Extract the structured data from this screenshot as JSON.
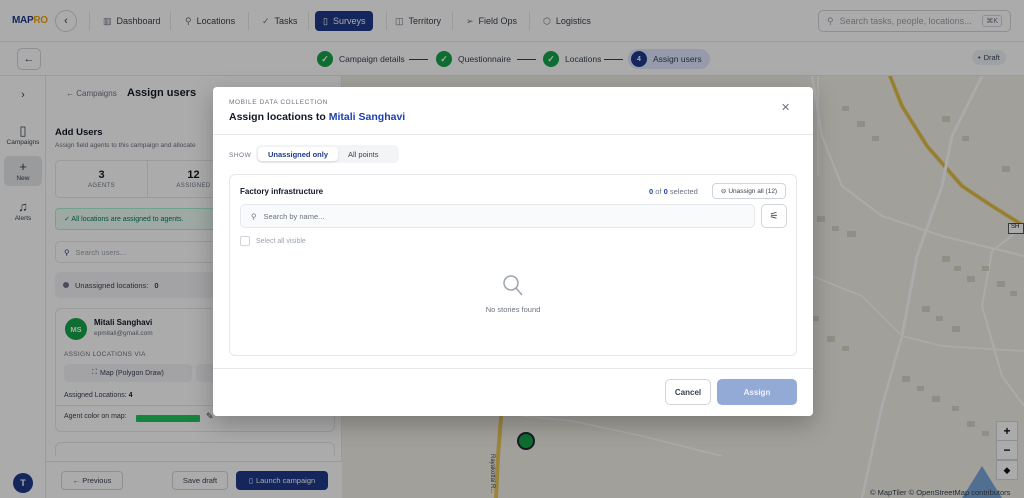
{
  "app": {
    "logo": "MAPRO",
    "nav": [
      {
        "label": "Dashboard",
        "icon": "bar-chart-icon"
      },
      {
        "label": "Locations",
        "icon": "map-pin-icon"
      },
      {
        "label": "Tasks",
        "icon": "check-icon"
      },
      {
        "label": "Surveys",
        "icon": "clipboard-icon",
        "active": true
      },
      {
        "label": "Territory",
        "icon": "map-icon"
      },
      {
        "label": "Field Ops",
        "icon": "send-icon"
      },
      {
        "label": "Logistics",
        "icon": "box-icon"
      }
    ],
    "search_placeholder": "Search tasks, people, locations...",
    "search_shortcut": "⌘K"
  },
  "stepper": {
    "steps": [
      {
        "label": "Campaign details",
        "state": "done",
        "mark": "✓"
      },
      {
        "label": "Questionnaire",
        "state": "done",
        "mark": "✓"
      },
      {
        "label": "Locations",
        "state": "done",
        "mark": "✓"
      },
      {
        "label": "Assign users",
        "state": "current",
        "mark": "4"
      }
    ],
    "status_badge": "Draft"
  },
  "rail": {
    "items": [
      {
        "label": "Campaigns",
        "icon": "clipboard-icon"
      },
      {
        "label": "New",
        "icon": "plus-icon",
        "active": true
      },
      {
        "label": "Alerts",
        "icon": "bell-icon"
      }
    ],
    "avatar_initial": "T"
  },
  "panel": {
    "breadcrumb": "← Campaigns",
    "title": "Assign users",
    "section_title": "Add Users",
    "section_desc": "Assign field agents to this campaign and allocate",
    "stats": [
      {
        "value": "3",
        "label": "AGENTS"
      },
      {
        "value": "12",
        "label": "ASSIGNED"
      }
    ],
    "alert": "✓ All locations are assigned to agents.",
    "search_placeholder": "Search users...",
    "unassigned_label": "Unassigned locations:",
    "unassigned_count": "0",
    "user": {
      "initials": "MS",
      "name": "Mitali Sanghavi",
      "email": "epmitali@gmail.com",
      "via_label": "ASSIGN LOCATIONS VIA",
      "method_label": "Map (Polygon Draw)",
      "assigned_label": "Assigned Locations:",
      "assigned_count": "4",
      "color_label": "Agent color on map:",
      "color": "#22c55e"
    },
    "footer": {
      "previous": "← Previous",
      "save_draft": "Save draft",
      "launch": "Launch campaign"
    }
  },
  "map": {
    "road_label": "Rayakottai R...",
    "shield_label": "SH",
    "attribution": "© MapTiler © OpenStreetMap contributors"
  },
  "modal": {
    "eyebrow": "MOBILE DATA COLLECTION",
    "title_prefix": "Assign locations to",
    "title_name": "Mitali Sanghavi",
    "show_label": "SHOW",
    "filters": [
      {
        "label": "Unassigned only",
        "active": true
      },
      {
        "label": "All points",
        "active": false
      }
    ],
    "group_title": "Factory infrastructure",
    "selected_count": "0",
    "total_count": "0",
    "selected_suffix": "selected",
    "of_label": "of",
    "unassign_all": "Unassign all (12)",
    "search_placeholder": "Search by name...",
    "select_all_label": "Select all visible",
    "empty_text": "No stories found",
    "cancel": "Cancel",
    "assign": "Assign"
  }
}
